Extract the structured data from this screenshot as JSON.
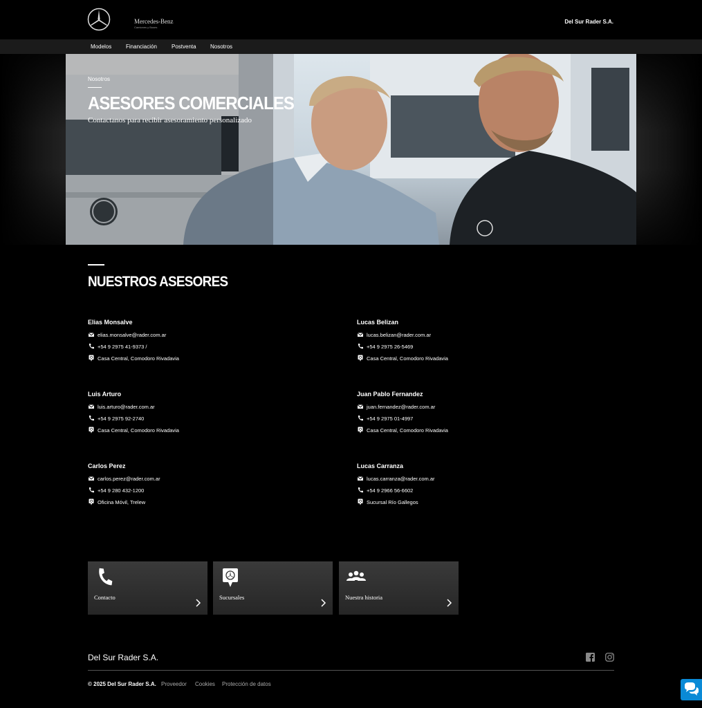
{
  "header": {
    "brand": "Mercedes-Benz",
    "brand_sub": "Camiones y Buses",
    "dealer": "Del Sur Rader S.A."
  },
  "nav": {
    "items": [
      {
        "label": "Modelos"
      },
      {
        "label": "Financiación"
      },
      {
        "label": "Postventa"
      },
      {
        "label": "Nosotros"
      }
    ]
  },
  "hero": {
    "eyebrow": "Nosotros",
    "title": "ASESORES COMERCIALES",
    "subtitle": "Contactanos para recibir asesoramiento personalizado"
  },
  "section": {
    "title": "NUESTROS ASESORES"
  },
  "advisors": [
    {
      "name": "Elias Monsalve",
      "email": "elias.monsalve@rader.com.ar",
      "phone": "+54 9 2975 41-9373 /",
      "location": "Casa Central, Comodoro Rivadavia"
    },
    {
      "name": "Lucas Belizan",
      "email": "lucas.belizan@rader.com.ar",
      "phone": "+54 9 2975 26-5469",
      "location": "Casa Central, Comodoro Rivadavia"
    },
    {
      "name": "Luis Arturo",
      "email": "luis.arturo@rader.com.ar",
      "phone": "+54 9 2975 92-2740",
      "location": "Casa Central, Comodoro Rivadavia"
    },
    {
      "name": "Juan Pablo Fernandez",
      "email": "juan.fernandez@rader.com.ar",
      "phone": "+54 9 2975 01-4997",
      "location": "Casa Central, Comodoro Rivadavia"
    },
    {
      "name": "Carlos Perez",
      "email": "carlos.perez@rader.com.ar",
      "phone": "+54 9 280 432-1200",
      "location": "Oficina Móvil, Trelew"
    },
    {
      "name": "Lucas Carranza",
      "email": "lucas.carranza@rader.com.ar",
      "phone": "+54 9 2966 56-6602",
      "location": "Sucursal Río Gallegos"
    }
  ],
  "tiles": [
    {
      "label": "Contacto",
      "icon": "phone-icon"
    },
    {
      "label": "Sucursales",
      "icon": "location-pin-icon"
    },
    {
      "label": "Nuestra historia",
      "icon": "people-icon"
    }
  ],
  "footer": {
    "name": "Del Sur Rader S.A.",
    "copyright": "© 2025 Del Sur Rader S.A.",
    "links": [
      {
        "label": "Proveedor"
      },
      {
        "label": "Cookies"
      },
      {
        "label": "Protección de datos"
      }
    ],
    "social": [
      "facebook-icon",
      "instagram-icon"
    ]
  },
  "colors": {
    "background": "#000000",
    "nav_bg": "#1b1b1b",
    "tile_bg": "#333333",
    "chat_accent": "#0a8ad6"
  }
}
